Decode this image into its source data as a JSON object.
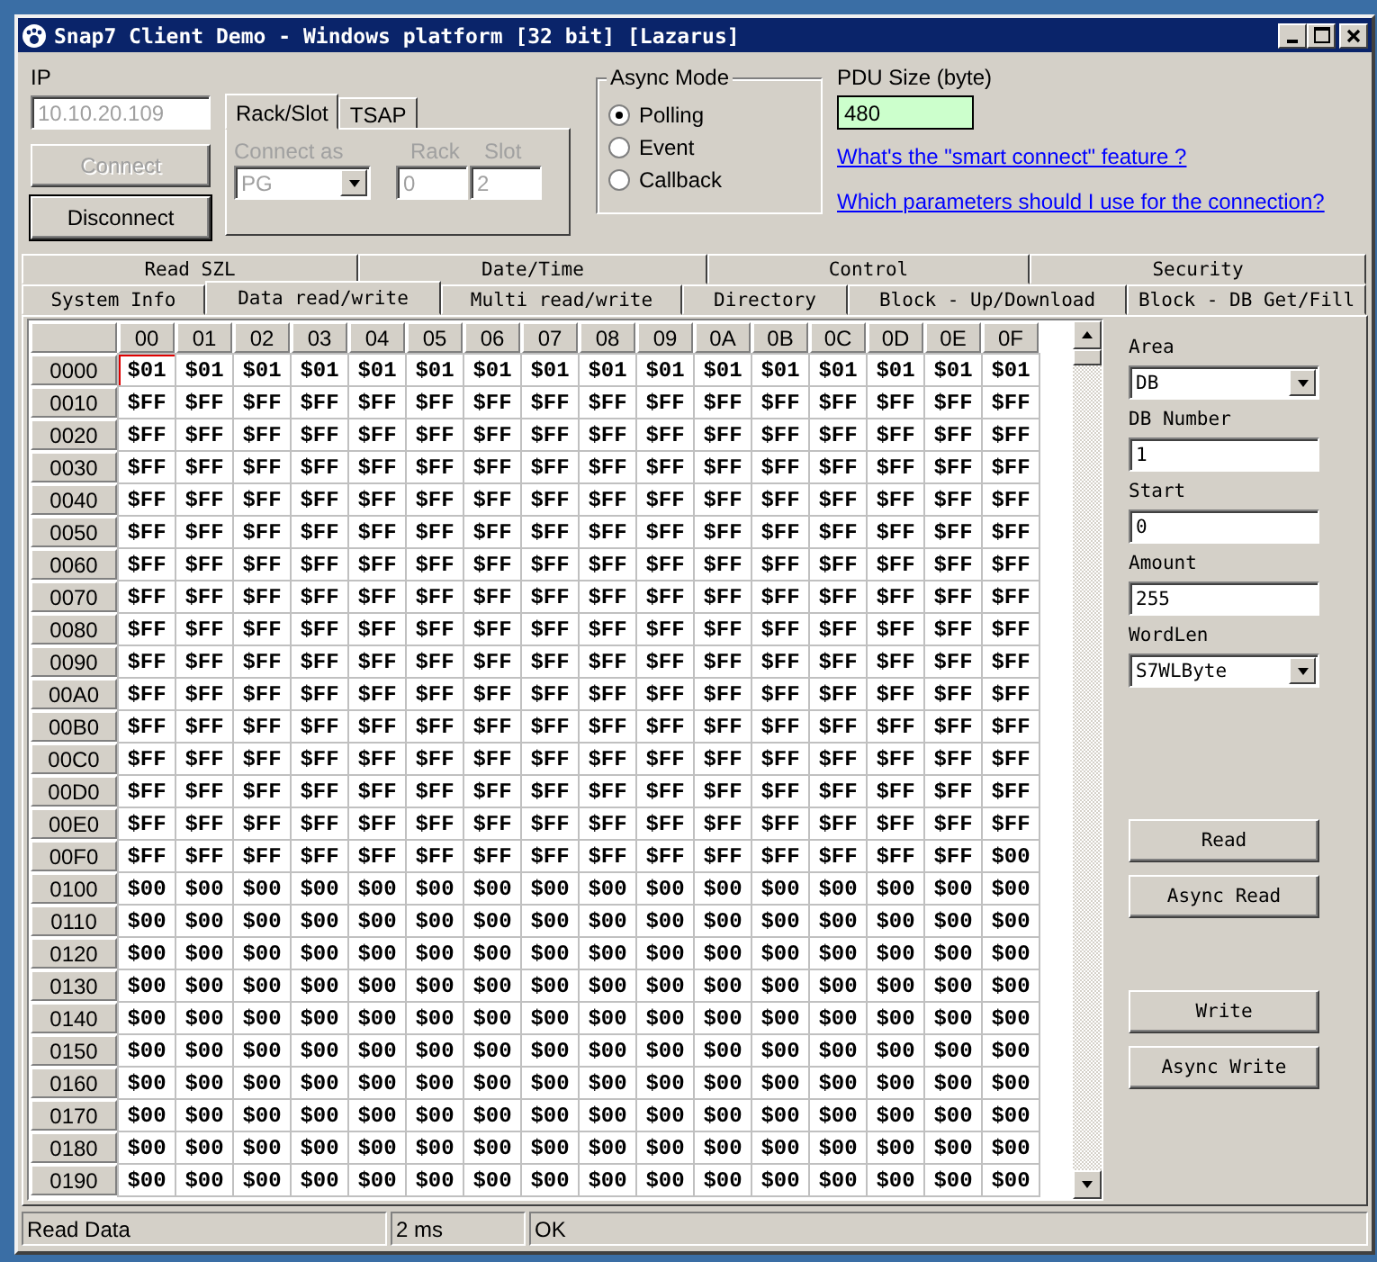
{
  "window": {
    "title": "Snap7 Client Demo - Windows platform [32 bit] [Lazarus]"
  },
  "connection": {
    "ip_label": "IP",
    "ip": {
      "value": "10.10.20.109",
      "disabled": true
    },
    "buttons": [
      {
        "label": "Connect",
        "disabled": true
      },
      {
        "label": "Disconnect",
        "disabled": false
      }
    ],
    "tabs": [
      {
        "label": "Rack/Slot",
        "selected": true
      },
      {
        "label": "TSAP",
        "selected": false
      }
    ],
    "connect_as": {
      "label": "Connect as",
      "value": "PG",
      "disabled": true
    },
    "rack": {
      "label": "Rack",
      "value": "0",
      "disabled": true
    },
    "slot": {
      "label": "Slot",
      "value": "2",
      "disabled": true
    }
  },
  "async_mode": {
    "title": "Async Mode",
    "options": [
      {
        "label": "Polling",
        "selected": true
      },
      {
        "label": "Event",
        "selected": false
      },
      {
        "label": "Callback",
        "selected": false
      }
    ]
  },
  "pdu": {
    "label": "PDU Size (byte)",
    "value": "480"
  },
  "links": [
    "What's the \"smart connect\" feature ?",
    "Which parameters should I use for the connection?"
  ],
  "tab_rows": [
    [
      {
        "label": "Read SZL",
        "selected": false
      },
      {
        "label": "Date/Time",
        "selected": false
      },
      {
        "label": "Control",
        "selected": false
      },
      {
        "label": "Security",
        "selected": false
      }
    ],
    [
      {
        "label": "System Info",
        "selected": false
      },
      {
        "label": "Data read/write",
        "selected": true
      },
      {
        "label": "Multi read/write",
        "selected": false
      },
      {
        "label": "Directory",
        "selected": false
      },
      {
        "label": "Block - Up/Download",
        "selected": false
      },
      {
        "label": "Block - DB Get/Fill",
        "selected": false
      }
    ]
  ],
  "grid": {
    "columns": [
      "00",
      "01",
      "02",
      "03",
      "04",
      "05",
      "06",
      "07",
      "08",
      "09",
      "0A",
      "0B",
      "0C",
      "0D",
      "0E",
      "0F"
    ],
    "rows": [
      {
        "address": "0000",
        "cells": [
          "$01",
          "$01",
          "$01",
          "$01",
          "$01",
          "$01",
          "$01",
          "$01",
          "$01",
          "$01",
          "$01",
          "$01",
          "$01",
          "$01",
          "$01",
          "$01"
        ]
      },
      {
        "address": "0010",
        "cells": [
          "$FF",
          "$FF",
          "$FF",
          "$FF",
          "$FF",
          "$FF",
          "$FF",
          "$FF",
          "$FF",
          "$FF",
          "$FF",
          "$FF",
          "$FF",
          "$FF",
          "$FF",
          "$FF"
        ]
      },
      {
        "address": "0020",
        "cells": [
          "$FF",
          "$FF",
          "$FF",
          "$FF",
          "$FF",
          "$FF",
          "$FF",
          "$FF",
          "$FF",
          "$FF",
          "$FF",
          "$FF",
          "$FF",
          "$FF",
          "$FF",
          "$FF"
        ]
      },
      {
        "address": "0030",
        "cells": [
          "$FF",
          "$FF",
          "$FF",
          "$FF",
          "$FF",
          "$FF",
          "$FF",
          "$FF",
          "$FF",
          "$FF",
          "$FF",
          "$FF",
          "$FF",
          "$FF",
          "$FF",
          "$FF"
        ]
      },
      {
        "address": "0040",
        "cells": [
          "$FF",
          "$FF",
          "$FF",
          "$FF",
          "$FF",
          "$FF",
          "$FF",
          "$FF",
          "$FF",
          "$FF",
          "$FF",
          "$FF",
          "$FF",
          "$FF",
          "$FF",
          "$FF"
        ]
      },
      {
        "address": "0050",
        "cells": [
          "$FF",
          "$FF",
          "$FF",
          "$FF",
          "$FF",
          "$FF",
          "$FF",
          "$FF",
          "$FF",
          "$FF",
          "$FF",
          "$FF",
          "$FF",
          "$FF",
          "$FF",
          "$FF"
        ]
      },
      {
        "address": "0060",
        "cells": [
          "$FF",
          "$FF",
          "$FF",
          "$FF",
          "$FF",
          "$FF",
          "$FF",
          "$FF",
          "$FF",
          "$FF",
          "$FF",
          "$FF",
          "$FF",
          "$FF",
          "$FF",
          "$FF"
        ]
      },
      {
        "address": "0070",
        "cells": [
          "$FF",
          "$FF",
          "$FF",
          "$FF",
          "$FF",
          "$FF",
          "$FF",
          "$FF",
          "$FF",
          "$FF",
          "$FF",
          "$FF",
          "$FF",
          "$FF",
          "$FF",
          "$FF"
        ]
      },
      {
        "address": "0080",
        "cells": [
          "$FF",
          "$FF",
          "$FF",
          "$FF",
          "$FF",
          "$FF",
          "$FF",
          "$FF",
          "$FF",
          "$FF",
          "$FF",
          "$FF",
          "$FF",
          "$FF",
          "$FF",
          "$FF"
        ]
      },
      {
        "address": "0090",
        "cells": [
          "$FF",
          "$FF",
          "$FF",
          "$FF",
          "$FF",
          "$FF",
          "$FF",
          "$FF",
          "$FF",
          "$FF",
          "$FF",
          "$FF",
          "$FF",
          "$FF",
          "$FF",
          "$FF"
        ]
      },
      {
        "address": "00A0",
        "cells": [
          "$FF",
          "$FF",
          "$FF",
          "$FF",
          "$FF",
          "$FF",
          "$FF",
          "$FF",
          "$FF",
          "$FF",
          "$FF",
          "$FF",
          "$FF",
          "$FF",
          "$FF",
          "$FF"
        ]
      },
      {
        "address": "00B0",
        "cells": [
          "$FF",
          "$FF",
          "$FF",
          "$FF",
          "$FF",
          "$FF",
          "$FF",
          "$FF",
          "$FF",
          "$FF",
          "$FF",
          "$FF",
          "$FF",
          "$FF",
          "$FF",
          "$FF"
        ]
      },
      {
        "address": "00C0",
        "cells": [
          "$FF",
          "$FF",
          "$FF",
          "$FF",
          "$FF",
          "$FF",
          "$FF",
          "$FF",
          "$FF",
          "$FF",
          "$FF",
          "$FF",
          "$FF",
          "$FF",
          "$FF",
          "$FF"
        ]
      },
      {
        "address": "00D0",
        "cells": [
          "$FF",
          "$FF",
          "$FF",
          "$FF",
          "$FF",
          "$FF",
          "$FF",
          "$FF",
          "$FF",
          "$FF",
          "$FF",
          "$FF",
          "$FF",
          "$FF",
          "$FF",
          "$FF"
        ]
      },
      {
        "address": "00E0",
        "cells": [
          "$FF",
          "$FF",
          "$FF",
          "$FF",
          "$FF",
          "$FF",
          "$FF",
          "$FF",
          "$FF",
          "$FF",
          "$FF",
          "$FF",
          "$FF",
          "$FF",
          "$FF",
          "$FF"
        ]
      },
      {
        "address": "00F0",
        "cells": [
          "$FF",
          "$FF",
          "$FF",
          "$FF",
          "$FF",
          "$FF",
          "$FF",
          "$FF",
          "$FF",
          "$FF",
          "$FF",
          "$FF",
          "$FF",
          "$FF",
          "$FF",
          "$00"
        ]
      },
      {
        "address": "0100",
        "cells": [
          "$00",
          "$00",
          "$00",
          "$00",
          "$00",
          "$00",
          "$00",
          "$00",
          "$00",
          "$00",
          "$00",
          "$00",
          "$00",
          "$00",
          "$00",
          "$00"
        ]
      },
      {
        "address": "0110",
        "cells": [
          "$00",
          "$00",
          "$00",
          "$00",
          "$00",
          "$00",
          "$00",
          "$00",
          "$00",
          "$00",
          "$00",
          "$00",
          "$00",
          "$00",
          "$00",
          "$00"
        ]
      },
      {
        "address": "0120",
        "cells": [
          "$00",
          "$00",
          "$00",
          "$00",
          "$00",
          "$00",
          "$00",
          "$00",
          "$00",
          "$00",
          "$00",
          "$00",
          "$00",
          "$00",
          "$00",
          "$00"
        ]
      },
      {
        "address": "0130",
        "cells": [
          "$00",
          "$00",
          "$00",
          "$00",
          "$00",
          "$00",
          "$00",
          "$00",
          "$00",
          "$00",
          "$00",
          "$00",
          "$00",
          "$00",
          "$00",
          "$00"
        ]
      },
      {
        "address": "0140",
        "cells": [
          "$00",
          "$00",
          "$00",
          "$00",
          "$00",
          "$00",
          "$00",
          "$00",
          "$00",
          "$00",
          "$00",
          "$00",
          "$00",
          "$00",
          "$00",
          "$00"
        ]
      },
      {
        "address": "0150",
        "cells": [
          "$00",
          "$00",
          "$00",
          "$00",
          "$00",
          "$00",
          "$00",
          "$00",
          "$00",
          "$00",
          "$00",
          "$00",
          "$00",
          "$00",
          "$00",
          "$00"
        ]
      },
      {
        "address": "0160",
        "cells": [
          "$00",
          "$00",
          "$00",
          "$00",
          "$00",
          "$00",
          "$00",
          "$00",
          "$00",
          "$00",
          "$00",
          "$00",
          "$00",
          "$00",
          "$00",
          "$00"
        ]
      },
      {
        "address": "0170",
        "cells": [
          "$00",
          "$00",
          "$00",
          "$00",
          "$00",
          "$00",
          "$00",
          "$00",
          "$00",
          "$00",
          "$00",
          "$00",
          "$00",
          "$00",
          "$00",
          "$00"
        ]
      },
      {
        "address": "0180",
        "cells": [
          "$00",
          "$00",
          "$00",
          "$00",
          "$00",
          "$00",
          "$00",
          "$00",
          "$00",
          "$00",
          "$00",
          "$00",
          "$00",
          "$00",
          "$00",
          "$00"
        ]
      },
      {
        "address": "0190",
        "cells": [
          "$00",
          "$00",
          "$00",
          "$00",
          "$00",
          "$00",
          "$00",
          "$00",
          "$00",
          "$00",
          "$00",
          "$00",
          "$00",
          "$00",
          "$00",
          "$00"
        ]
      }
    ]
  },
  "params": [
    {
      "kind": "select",
      "label": "Area",
      "value": "DB"
    },
    {
      "kind": "input",
      "label": "DB Number",
      "value": "1"
    },
    {
      "kind": "input",
      "label": "Start",
      "value": "0"
    },
    {
      "kind": "input",
      "label": "Amount",
      "value": "255"
    },
    {
      "kind": "select",
      "label": "WordLen",
      "value": "S7WLByte"
    }
  ],
  "action_groups": [
    [
      "Read",
      "Async Read"
    ],
    [
      "Write",
      "Async Write"
    ]
  ],
  "status_bar": [
    "Read Data",
    "2 ms",
    "OK"
  ]
}
